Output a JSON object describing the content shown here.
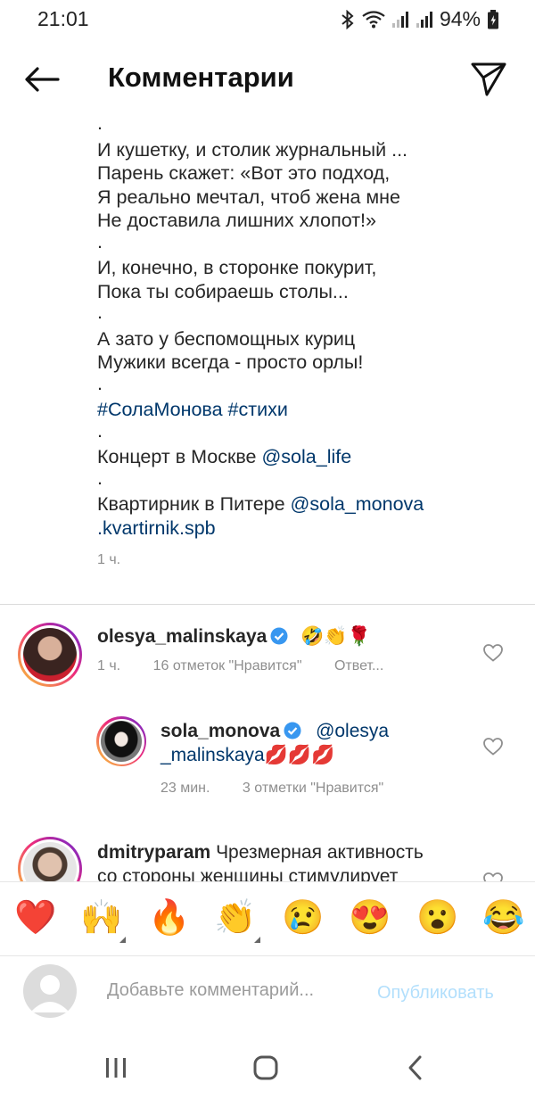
{
  "status_bar": {
    "time": "21:01",
    "battery": "94%",
    "icons": [
      "bluetooth-icon",
      "wifi-icon",
      "signal-icon",
      "signal-icon",
      "battery-icon"
    ]
  },
  "header": {
    "title": "Комментарии",
    "back_icon": "back-arrow-icon",
    "share_icon": "send-icon"
  },
  "caption": {
    "lines": [
      "И кушетку, и столик журнальный ...",
      "Парень скажет: «Вот это подход,",
      "Я реально мечтал, чтоб жена мне",
      "Не доставила лишних хлопот!»",
      "И, конечно, в сторонке покурит,",
      "Пока ты собираешь столы...",
      "А зато у беспомощных куриц",
      "Мужики всегда - просто орлы!"
    ],
    "dot": ".",
    "hashtags": "#СолаМонова #стихи",
    "concert_text": "Концерт в Москве",
    "concert_mention": "@sola_life",
    "flat_text": "Квартирник в Питере",
    "flat_mention_1": "@sola_monova",
    "flat_mention_2": ".kvartirnik.spb",
    "time": "1 ч."
  },
  "comments": [
    {
      "username": "olesya_malinskaya",
      "verified": true,
      "text": "🤣👏🌹",
      "time": "1 ч.",
      "likes": "16 отметок \"Нравится\"",
      "reply": "Ответ..."
    },
    {
      "username": "sola_monova",
      "verified": true,
      "mention_1": "@olesya",
      "mention_2": "_malinskaya",
      "text": "💋💋💋",
      "time": "23 мин.",
      "likes": "3 отметки \"Нравится\""
    },
    {
      "username": "dmitryparam",
      "text_1": "Чрезмерная активность",
      "text_2": "со стороны женщины стимулирует"
    }
  ],
  "emoji_bar": [
    "❤️",
    "🙌",
    "🔥",
    "👏",
    "😢",
    "😍",
    "😮",
    "😂"
  ],
  "composer": {
    "placeholder": "Добавьте комментарий...",
    "publish": "Опубликовать"
  },
  "nav": {
    "icons": [
      "recent-apps-icon",
      "home-icon",
      "back-icon"
    ]
  },
  "colors": {
    "link": "#00376b",
    "publish_disabled": "#b2dffc",
    "verified": "#3897f0"
  }
}
